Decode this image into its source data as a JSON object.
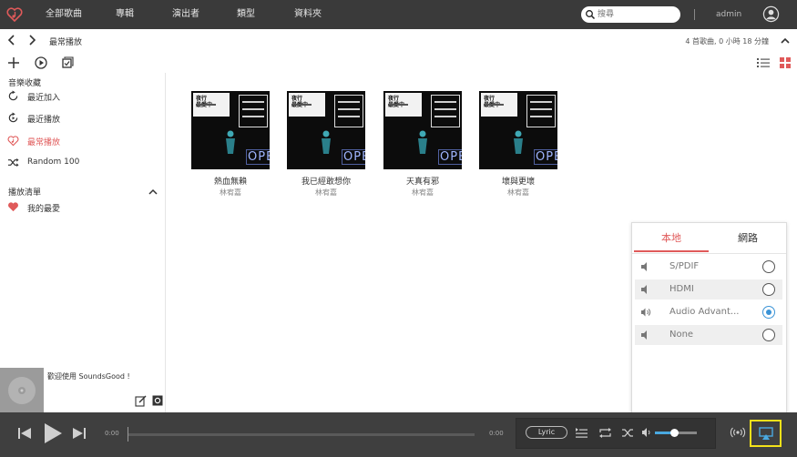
{
  "topbar": {
    "nav": [
      "全部歌曲",
      "專輯",
      "演出者",
      "類型",
      "資料夾"
    ],
    "search_placeholder": "搜尋",
    "user": "admin"
  },
  "breadcrumb": {
    "title": "最常播放",
    "stats": "4 首歌曲, 0 小時 18 分鐘"
  },
  "sidebar": {
    "library_title": "音樂收藏",
    "library_items": [
      {
        "label": "最近加入",
        "active": false
      },
      {
        "label": "最近播放",
        "active": false
      },
      {
        "label": "最常播放",
        "active": true
      },
      {
        "label": "Random 100",
        "active": false
      }
    ],
    "playlist_title": "播放清單",
    "playlists": [
      {
        "label": "我的最愛"
      }
    ],
    "now_playing_text": "歡迎使用 SoundsGood !"
  },
  "albums": [
    {
      "title": "熱血無賴",
      "artist": "林宥嘉"
    },
    {
      "title": "我已經敢想你",
      "artist": "林宥嘉"
    },
    {
      "title": "天真有邪",
      "artist": "林宥嘉"
    },
    {
      "title": "壞與更壞",
      "artist": "林宥嘉"
    }
  ],
  "output_panel": {
    "tabs": [
      "本地",
      "網路"
    ],
    "active_tab": "本地",
    "devices": [
      {
        "name": "S/PDIF",
        "selected": false
      },
      {
        "name": "HDMI",
        "selected": false
      },
      {
        "name": "Audio Advant...",
        "selected": true
      },
      {
        "name": "None",
        "selected": false
      }
    ]
  },
  "player": {
    "elapsed": "0:00",
    "duration": "0:00",
    "lyric_label": "Lyric",
    "volume_fraction": 0.45
  },
  "colors": {
    "accent": "#e05a5a",
    "topbar": "#3a3a3a",
    "player": "#3f3f3f",
    "selected": "#3a93d6",
    "highlight": "#f3e11a"
  }
}
